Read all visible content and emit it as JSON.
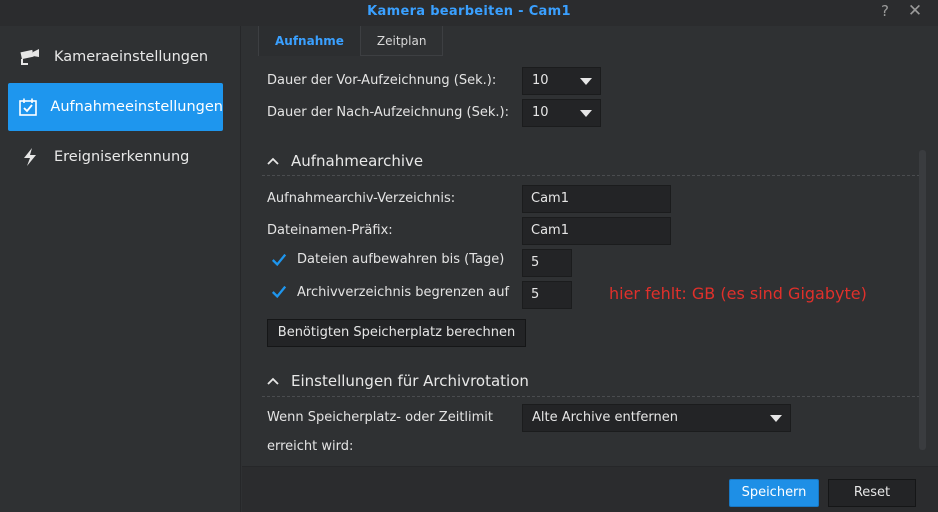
{
  "window": {
    "title": "Kamera bearbeiten - Cam1",
    "help_glyph": "?",
    "close_glyph": "✕"
  },
  "sidebar": {
    "items": [
      {
        "label": "Kameraeinstellungen",
        "icon": "camera-icon"
      },
      {
        "label": "Aufnahmeeinstellungen",
        "icon": "calendar-check-icon",
        "active": true
      },
      {
        "label": "Ereigniserkennung",
        "icon": "lightning-icon"
      }
    ]
  },
  "tabs": [
    {
      "label": "Aufnahme",
      "active": true
    },
    {
      "label": "Zeitplan"
    }
  ],
  "recording": {
    "pre_label": "Dauer der Vor-Aufzeichnung (Sek.):",
    "pre_value": "10",
    "post_label": "Dauer der Nach-Aufzeichnung (Sek.):",
    "post_value": "10"
  },
  "archive": {
    "section_title": "Aufnahmearchive",
    "dir_label": "Aufnahmearchiv-Verzeichnis:",
    "dir_value": "Cam1",
    "prefix_label": "Dateinamen-Präfix:",
    "prefix_value": "Cam1",
    "keep_label": "Dateien aufbewahren bis (Tage)",
    "keep_checked": true,
    "keep_value": "5",
    "limit_label": "Archivverzeichnis begrenzen auf",
    "limit_checked": true,
    "limit_value": "5",
    "calc_button": "Benötigten Speicherplatz berechnen",
    "annotation": "hier fehlt: GB (es sind Gigabyte)",
    "annotation_color": "#e0302b"
  },
  "rotation": {
    "section_title": "Einstellungen für Archivrotation",
    "label_line1": "Wenn Speicherplatz- oder Zeitlimit",
    "label_line2": "erreicht wird:",
    "value": "Alte Archive entfernen"
  },
  "footer": {
    "save_label": "Speichern",
    "reset_label": "Reset"
  },
  "colors": {
    "accent": "#1e96ee",
    "title": "#3aa0ff",
    "background": "#2f3133"
  }
}
